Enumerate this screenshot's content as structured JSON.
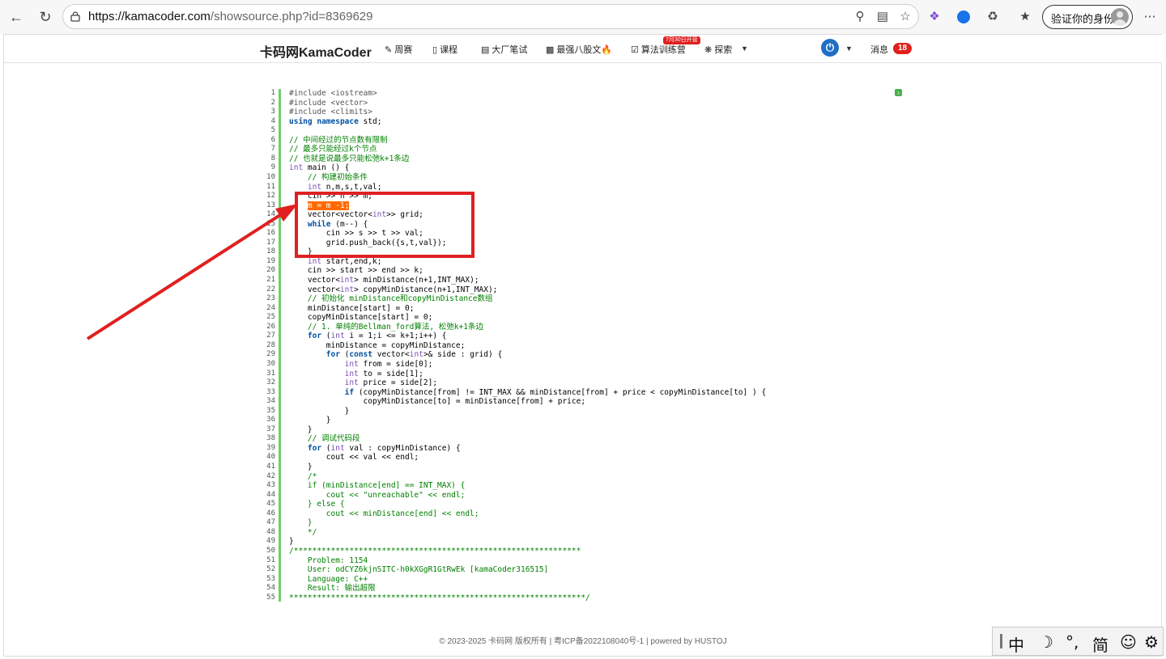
{
  "browser": {
    "url_domain": "https://kamacoder.com",
    "url_path": "/showsource.php?id=8369629",
    "verify_label": "验证你的身份"
  },
  "site_nav": {
    "brand": "卡码网KamaCoder",
    "items": [
      {
        "icon": "pen-icon",
        "label": "周赛"
      },
      {
        "icon": "book-icon",
        "label": "课程"
      },
      {
        "icon": "doc-icon",
        "label": "大厂笔试"
      },
      {
        "icon": "code-icon",
        "label": "最强八股文🔥"
      },
      {
        "icon": "calendar-icon",
        "label": "算法训练营"
      },
      {
        "icon": "compass-icon",
        "label": "探索"
      }
    ],
    "training_badge": "7月30日开营",
    "messages_label": "消息",
    "messages_count": "18"
  },
  "code": {
    "lines": [
      "#include <iostream>",
      "#include <vector>",
      "#include <climits>",
      "using namespace std;",
      "",
      "// 中间经过的节点数有限制",
      "// 最多只能经过k个节点",
      "// 也就是说最多只能松弛k+1条边",
      "int main () {",
      "    // 构建初始条件",
      "    int n,m,s,t,val;",
      "    cin >> n >> m;",
      "    m = m -1;",
      "    vector<vector<int>> grid;",
      "    while (m--) {",
      "        cin >> s >> t >> val;",
      "        grid.push_back({s,t,val});",
      "    }",
      "    int start,end,k;",
      "    cin >> start >> end >> k;",
      "    vector<int> minDistance(n+1,INT_MAX);",
      "    vector<int> copyMinDistance(n+1,INT_MAX);",
      "    // 初始化 minDistance和copyMinDistance数组",
      "    minDistance[start] = 0;",
      "    copyMinDistance[start] = 0;",
      "    // 1. 单纯的Bellman_ford算法, 松弛k+1条边",
      "    for (int i = 1;i <= k+1;i++) {",
      "        minDistance = copyMinDistance;",
      "        for (const vector<int>& side : grid) {",
      "            int from = side[0];",
      "            int to = side[1];",
      "            int price = side[2];",
      "            if (copyMinDistance[from] != INT_MAX && minDistance[from] + price < copyMinDistance[to] ) {",
      "                copyMinDistance[to] = minDistance[from] + price;",
      "            }",
      "        }",
      "    }",
      "    // 调试代码段",
      "    for (int val : copyMinDistance) {",
      "        cout << val << endl;",
      "    }",
      "    /*",
      "    if (minDistance[end] == INT_MAX) {",
      "        cout << \"unreachable\" << endl;",
      "    } else {",
      "        cout << minDistance[end] << endl;",
      "    }",
      "    */",
      "}",
      "/**************************************************************",
      "    Problem: 1154",
      "    User: odCYZ6kjnSITC-h0kXGgR1GtRwEk [kamaCoder316515]",
      "    Language: C++",
      "    Result: 输出超限",
      "****************************************************************/"
    ],
    "highlight_line": 13
  },
  "footer": "© 2023-2025 卡码网 版权所有 | 粤ICP备2022108040号-1 | powered by HUSTOJ",
  "ime": [
    "中",
    "☽",
    "°,",
    "简",
    "☺",
    "⚙"
  ],
  "annotation_color": "#e02020"
}
